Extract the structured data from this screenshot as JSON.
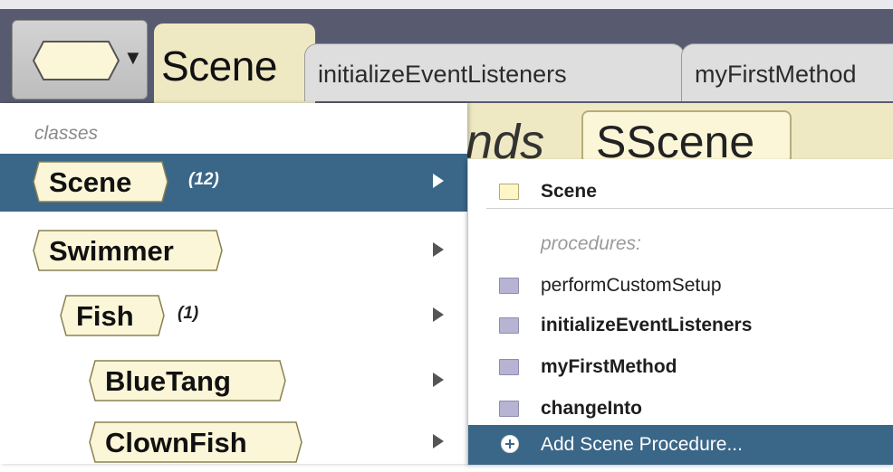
{
  "tabs": {
    "active": "Scene",
    "others": [
      "initializeEventListeners",
      "myFirstMethod"
    ]
  },
  "editor": {
    "keyword": "nds",
    "type": "SScene"
  },
  "menu": {
    "header": "classes",
    "items": [
      {
        "label": "Scene",
        "count": "(12)",
        "selected": true
      },
      {
        "label": "Swimmer",
        "count": "",
        "selected": false
      },
      {
        "label": "Fish",
        "count": "(1)",
        "selected": false
      },
      {
        "label": "BlueTang",
        "count": "",
        "selected": false
      },
      {
        "label": "ClownFish",
        "count": "",
        "selected": false
      }
    ]
  },
  "submenu": {
    "class_item": "Scene",
    "header": "procedures:",
    "procedures": [
      "performCustomSetup",
      "initializeEventListeners",
      "myFirstMethod",
      "changeInto"
    ],
    "add_action": "Add Scene Procedure..."
  },
  "colors": {
    "topband": "#585b70",
    "tab_active": "#efe9c3",
    "selection": "#3a6688",
    "chip_fill": "#fbf6d8"
  },
  "icons": {
    "class_dropdown": "hexagon-chip-icon",
    "arrow": "chevron-down-icon",
    "submenu_arrow": "chevron-right-icon",
    "folder": "folder-icon",
    "add": "plus-circle-icon"
  }
}
